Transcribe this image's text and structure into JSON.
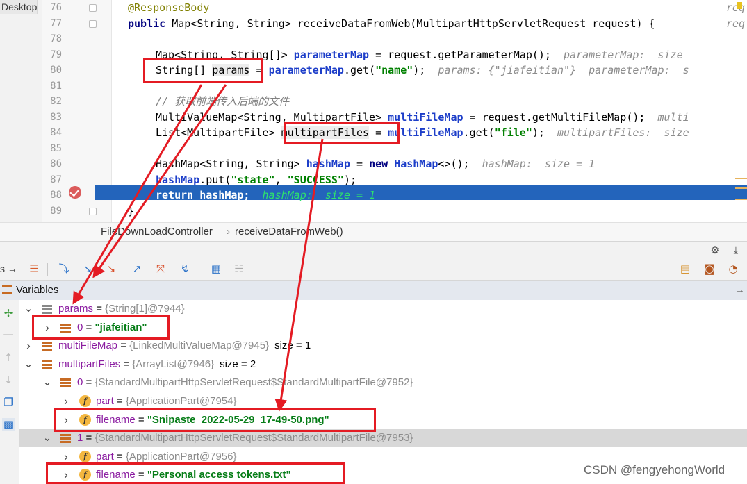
{
  "project_tab": "Desktop",
  "editor": {
    "lines": [
      {
        "n": "76",
        "tokens": [
          [
            "ann",
            "@ResponseBody"
          ]
        ],
        "trail": [
          [
            "hint",
            "req"
          ]
        ]
      },
      {
        "n": "77",
        "tokens": [
          [
            "kw",
            "public "
          ],
          [
            "",
            "Map<String, String> receiveDataFromWeb(MultipartHttpServletRequest request) {  "
          ]
        ],
        "trail": [
          [
            "hint",
            "req"
          ]
        ]
      },
      {
        "n": "78",
        "tokens": []
      },
      {
        "n": "79",
        "tokens": [
          [
            "",
            "Map<String, String[]> "
          ],
          [
            "fldb",
            "parameterMap"
          ],
          [
            "",
            " = request.getParameterMap();  "
          ],
          [
            "hint",
            "parameterMap:  size"
          ]
        ]
      },
      {
        "n": "80",
        "tokens": [
          [
            "",
            "String[] "
          ],
          [
            "var",
            "params"
          ],
          [
            "",
            " = "
          ],
          [
            "fldb",
            "parameterMap"
          ],
          [
            "",
            ".get("
          ],
          [
            "str",
            "\"name\""
          ],
          [
            "",
            ");  "
          ],
          [
            "hint",
            "params: {\"jiafeitian\"}  parameterMap:  s"
          ]
        ]
      },
      {
        "n": "81",
        "tokens": []
      },
      {
        "n": "82",
        "tokens": [
          [
            "cmt",
            "// 获取前端传入后端的文件"
          ]
        ]
      },
      {
        "n": "83",
        "tokens": [
          [
            "",
            "MultiValueMap<String, MultipartFile> "
          ],
          [
            "fldb",
            "multiFileMap"
          ],
          [
            "",
            " = request.getMultiFileMap();  "
          ],
          [
            "hint",
            "multi"
          ]
        ]
      },
      {
        "n": "84",
        "tokens": [
          [
            "",
            "List<MultipartFile> "
          ],
          [
            "var",
            "multipartFiles"
          ],
          [
            "",
            " = "
          ],
          [
            "fldb",
            "multiFileMap"
          ],
          [
            "",
            ".get("
          ],
          [
            "str",
            "\"file\""
          ],
          [
            "",
            ");  "
          ],
          [
            "hint",
            "multipartFiles:  size"
          ]
        ]
      },
      {
        "n": "85",
        "tokens": []
      },
      {
        "n": "86",
        "tokens": [
          [
            "",
            "HashMap<String, String> "
          ],
          [
            "fldb",
            "hashMap"
          ],
          [
            "",
            " = "
          ],
          [
            "kw",
            "new "
          ],
          [
            "fldb",
            "HashMap"
          ],
          [
            "",
            "<>();  "
          ],
          [
            "hint",
            "hashMap:  size = 1"
          ]
        ]
      },
      {
        "n": "87",
        "tokens": [
          [
            "fldb",
            "hashMap"
          ],
          [
            "",
            ".put("
          ],
          [
            "str",
            "\"state\""
          ],
          [
            "",
            ", "
          ],
          [
            "str",
            "\"SUCCESS\""
          ],
          [
            "",
            ");"
          ]
        ]
      },
      {
        "n": "88",
        "tokens": [
          [
            "white",
            "return hashMap;  "
          ],
          [
            "hint-hl",
            "hashMap:  size = 1"
          ]
        ]
      },
      {
        "n": "89",
        "tokens": [
          [
            "",
            "}"
          ]
        ]
      }
    ]
  },
  "breadcrumb": {
    "file": "FileDownLoadController",
    "sep": "›",
    "method": "receiveDataFromWeb()"
  },
  "debug": {
    "tab_stub": "s →",
    "variables_title": "Variables",
    "pin": "→",
    "tree": [
      {
        "indent": 0,
        "expanded": true,
        "icon": "array-icon",
        "name": "params",
        "type": "{String[1]@7944}",
        "extra": ""
      },
      {
        "indent": 1,
        "expanded": false,
        "icon": "field-icon",
        "name": "0",
        "value": "\"jiafeitian\"",
        "extra": ""
      },
      {
        "indent": 0,
        "expanded": false,
        "icon": "field-icon",
        "name": "multiFileMap",
        "type": "{LinkedMultiValueMap@7945}",
        "extra": "size = 1"
      },
      {
        "indent": 0,
        "expanded": true,
        "icon": "field-icon",
        "name": "multipartFiles",
        "type": "{ArrayList@7946}",
        "extra": "size = 2"
      },
      {
        "indent": 1,
        "expanded": true,
        "icon": "field-icon",
        "name": "0",
        "type": "{StandardMultipartHttpServletRequest$StandardMultipartFile@7952}",
        "extra": ""
      },
      {
        "indent": 2,
        "expanded": false,
        "icon": "f-icon",
        "name": "part",
        "type": "{ApplicationPart@7954}",
        "extra": ""
      },
      {
        "indent": 2,
        "expanded": false,
        "icon": "f-icon",
        "name": "filename",
        "value": "\"Snipaste_2022-05-29_17-49-50.png\"",
        "extra": ""
      },
      {
        "indent": 1,
        "expanded": true,
        "icon": "field-icon",
        "name": "1",
        "type": "{StandardMultipartHttpServletRequest$StandardMultipartFile@7953}",
        "extra": "",
        "selected": true
      },
      {
        "indent": 2,
        "expanded": false,
        "icon": "f-icon",
        "name": "part",
        "type": "{ApplicationPart@7956}",
        "extra": ""
      },
      {
        "indent": 2,
        "expanded": false,
        "icon": "f-icon",
        "name": "filename",
        "value": "\"Personal access tokens.txt\"",
        "extra": ""
      }
    ]
  },
  "watermark": "CSDN @fengyehongWorld",
  "colors": {
    "accent": "#2364bb",
    "annotation_red": "#e41b23"
  }
}
